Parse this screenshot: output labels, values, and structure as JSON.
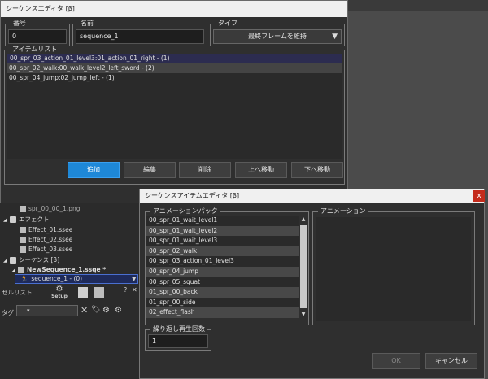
{
  "sequence_editor": {
    "title": "シーケンスエディタ [β]",
    "number_label": "番号",
    "number_value": "0",
    "name_label": "名前",
    "name_value": "sequence_1",
    "type_label": "タイプ",
    "type_value": "最終フレームを維持",
    "item_list_label": "アイテムリスト",
    "items": [
      "00_spr_03_action_01_level3:01_action_01_right - (1)",
      "00_spr_02_walk:00_walk_level2_left_sword - (2)",
      "00_spr_04_jump:02_jump_left - (1)"
    ],
    "buttons": {
      "add": "追加",
      "edit": "編集",
      "delete": "削除",
      "move_up": "上へ移動",
      "move_down": "下へ移動"
    }
  },
  "left_panel": {
    "tree": {
      "partial_file": "spr_00_00_1.png",
      "effect_folder": "エフェクト",
      "effect_files": [
        "Effect_01.ssee",
        "Effect_02.ssee",
        "Effect_03.ssee"
      ],
      "sequence_folder": "シーケンス [β]",
      "sequence_file": "NewSequence_1.ssqe *",
      "sequence_item": "sequence_1 - (0)"
    },
    "cell_list_label": "セルリスト",
    "setup_label": "Setup",
    "tag_label": "タグ",
    "help_label": "?",
    "close_label": "✕"
  },
  "item_editor": {
    "title": "シーケンスアイテムエディタ [β]",
    "close_label": "x",
    "anim_pack_label": "アニメーションパック",
    "animation_label": "アニメーション",
    "anim_packs": [
      "00_spr_01_wait_level1",
      "00_spr_01_wait_level2",
      "00_spr_01_wait_level3",
      "00_spr_02_walk",
      "00_spr_03_action_01_level3",
      "00_spr_04_jump",
      "00_spr_05_squat",
      "01_spr_00_back",
      "01_spr_00_side",
      "02_effect_flash"
    ],
    "repeat_label": "繰り返し再生回数",
    "repeat_value": "1",
    "ok_label": "OK",
    "cancel_label": "キャンセル"
  }
}
